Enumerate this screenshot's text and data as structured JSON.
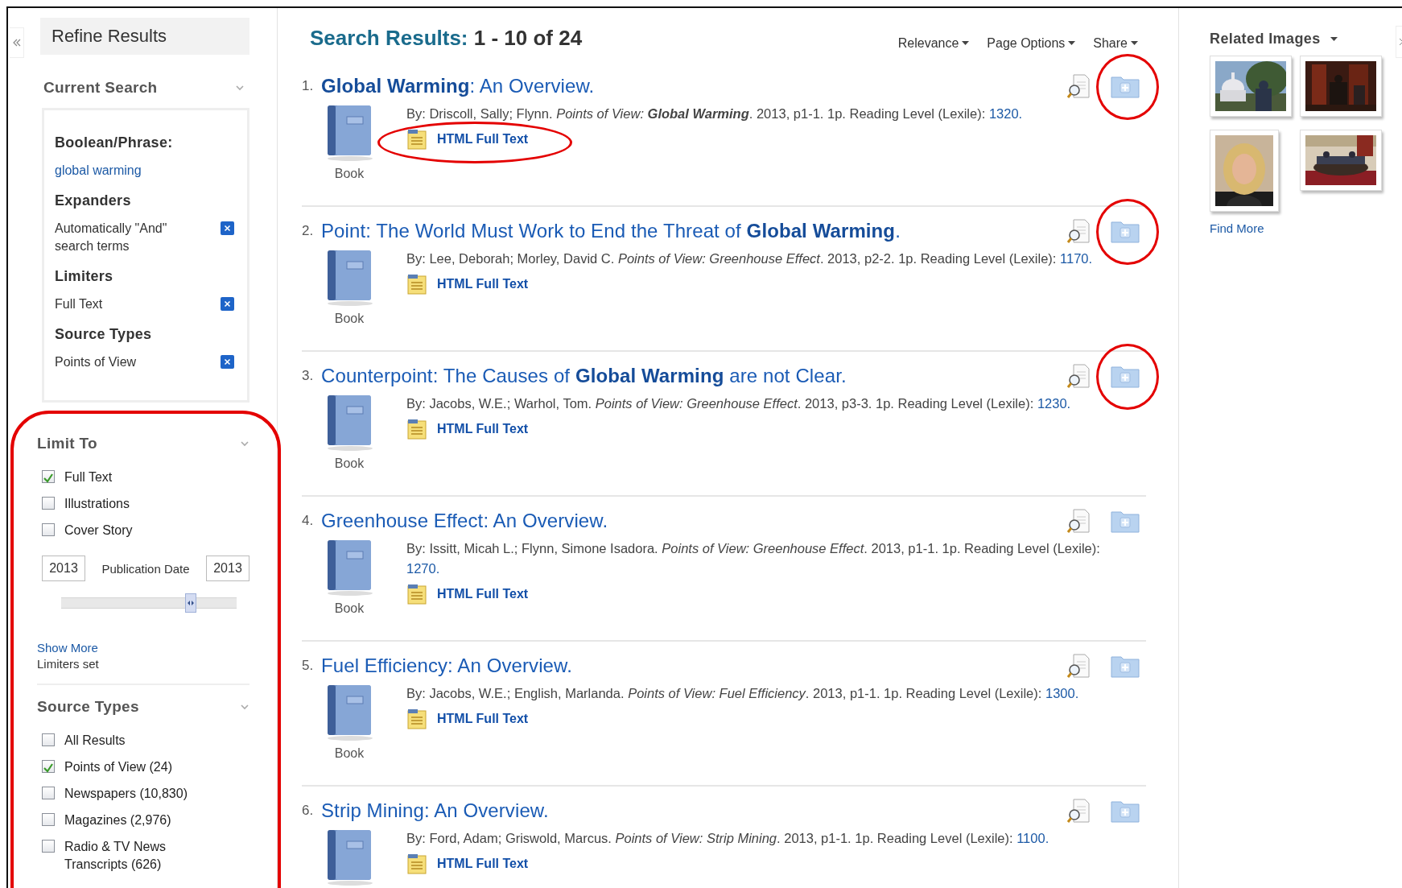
{
  "sidebar": {
    "title": "Refine Results",
    "current_search": {
      "title": "Current Search",
      "groups": [
        {
          "heading": "Boolean/Phrase:",
          "items": [
            {
              "kind": "link",
              "label": "global warming"
            }
          ]
        },
        {
          "heading": "Expanders",
          "items": [
            {
              "kind": "removable",
              "label": "Automatically \"And\" search terms"
            }
          ]
        },
        {
          "heading": "Limiters",
          "items": [
            {
              "kind": "removable",
              "label": "Full Text"
            }
          ]
        },
        {
          "heading": "Source Types",
          "items": [
            {
              "kind": "removable",
              "label": "Points of View"
            }
          ]
        }
      ]
    },
    "limit_to": {
      "title": "Limit To",
      "circled": true,
      "options": [
        {
          "label": "Full Text",
          "checked": true
        },
        {
          "label": "Illustrations",
          "checked": false
        },
        {
          "label": "Cover Story",
          "checked": false
        }
      ],
      "date_from": "2013",
      "date_label": "Publication Date",
      "date_to": "2013",
      "slider": {
        "level": 0.74
      },
      "show_more": "Show More",
      "status": "Limiters set"
    },
    "source_types": {
      "title": "Source Types",
      "options": [
        {
          "label": "All Results",
          "checked": false
        },
        {
          "label": "Points of View (24)",
          "checked": true
        },
        {
          "label": "Newspapers (10,830)",
          "checked": false
        },
        {
          "label": "Magazines (2,976)",
          "checked": false
        },
        {
          "label": "Radio & TV News Transcripts (626)",
          "checked": false
        }
      ]
    }
  },
  "results": {
    "title": "Search Results:",
    "range": "1 - 10 of 24",
    "controls": [
      "Relevance",
      "Page Options",
      "Share"
    ],
    "items": [
      {
        "number": "1.",
        "title": "**Global Warming**: An Overview.",
        "type": "Book",
        "authors": "By: Driscoll, Sally; Flynn.",
        "source": "Points of View: **Global Warming**",
        "details": ". 2013, p1-1. 1p. Reading Level (Lexile):",
        "lexile": "1320.",
        "link": "HTML Full Text",
        "link_circled": true,
        "folder_circled": true
      },
      {
        "number": "2.",
        "title": "Point: The World Must Work to End the Threat of **Global Warming**.",
        "type": "Book",
        "authors": "By: Lee, Deborah; Morley, David C.",
        "source": "Points of View: Greenhouse Effect",
        "details": ". 2013, p2-2. 1p. Reading Level (Lexile):",
        "lexile": "1170.",
        "link": "HTML Full Text",
        "link_circled": false,
        "folder_circled": true
      },
      {
        "number": "3.",
        "title": "Counterpoint: The Causes of **Global Warming** are not Clear.",
        "type": "Book",
        "authors": "By: Jacobs, W.E.; Warhol, Tom.",
        "source": "Points of View: Greenhouse Effect",
        "details": ". 2013, p3-3. 1p. Reading Level (Lexile):",
        "lexile": "1230.",
        "link": "HTML Full Text",
        "link_circled": false,
        "folder_circled": true
      },
      {
        "number": "4.",
        "title": "Greenhouse Effect: An Overview.",
        "type": "Book",
        "authors": "By: Issitt, Micah L.; Flynn, Simone Isadora.",
        "source": "Points of View: Greenhouse Effect",
        "details": ". 2013, p1-1. 1p. Reading Level (Lexile):",
        "lexile": "1270.",
        "link": "HTML Full Text",
        "link_circled": false,
        "folder_circled": false
      },
      {
        "number": "5.",
        "title": "Fuel Efficiency: An Overview.",
        "type": "Book",
        "authors": "By: Jacobs, W.E.; English, Marlanda.",
        "source": "Points of View: Fuel Efficiency",
        "details": ". 2013, p1-1. 1p. Reading Level (Lexile):",
        "lexile": "1300.",
        "link": "HTML Full Text",
        "link_circled": false,
        "folder_circled": false
      },
      {
        "number": "6.",
        "title": "Strip Mining: An Overview.",
        "authors": "By: Ford, Adam; Griswold, Marcus.",
        "source": "Points of View: Strip Mining",
        "details": ". 2013, p1-1. 1p. Reading Level (Lexile):",
        "lexile": "1100.",
        "link": "HTML Full Text",
        "link_circled": false,
        "folder_circled": false
      }
    ]
  },
  "related_images": {
    "title": "Related Images",
    "find_more": "Find More"
  }
}
